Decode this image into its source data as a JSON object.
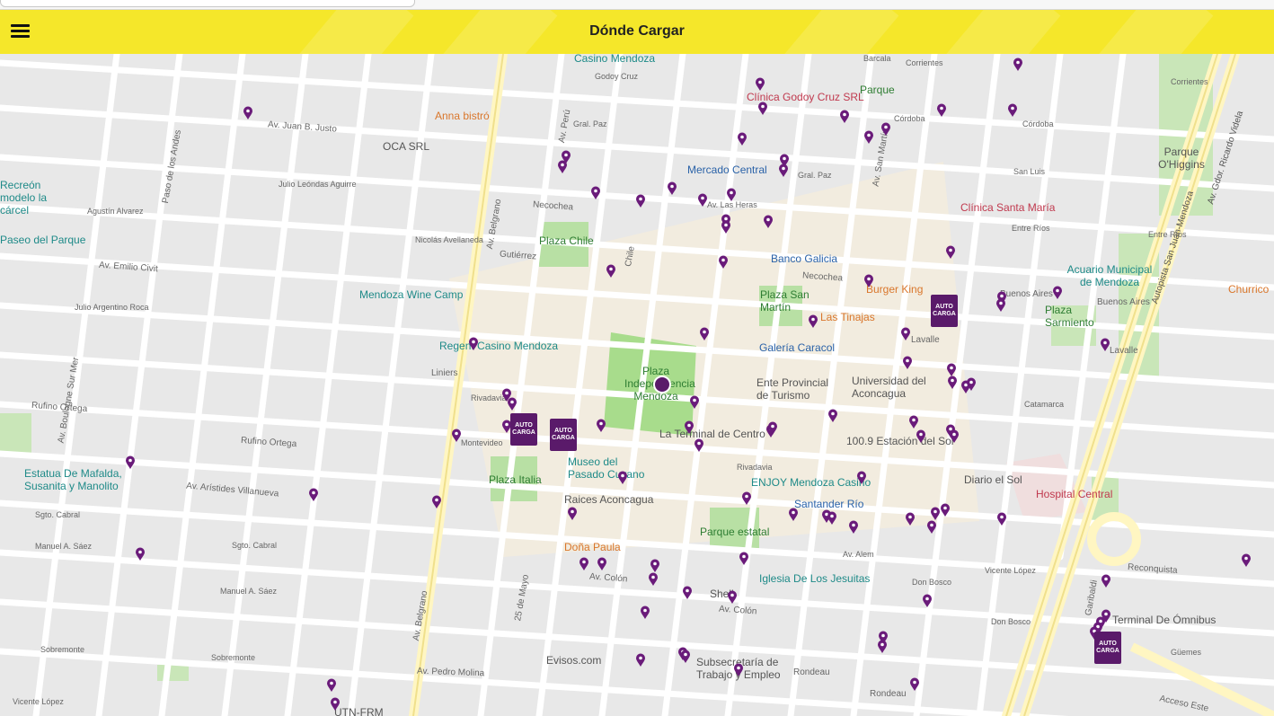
{
  "app": {
    "title": "Dónde Cargar",
    "menu_icon": "hamburger-menu-icon",
    "header_color": "#f5e72a",
    "pin_color": "#6a1b7a"
  },
  "map": {
    "streets": [
      "Av. Juan B. Justo",
      "Julio Leóndas Aguirre",
      "Agustín Alvarez",
      "Av. Emilio Civit",
      "Nicolás Avellaneda",
      "Gutiérrez",
      "Necochea",
      "Av. Boulogne Sur Mer",
      "Julio Argentino Roca",
      "Rufino Ortega",
      "Av. Arístides Villanueva",
      "Av. Belgrano",
      "Av. Colón",
      "Av. Pedro Molina",
      "Rivadavia",
      "Montevideo",
      "Godoy Cruz",
      "Av. San Martín",
      "Av. Las Heras",
      "Buenos Aires",
      "Lavalle",
      "Catamarca",
      "Garibaldi",
      "Reconquista",
      "Acceso Este",
      "Rondeau",
      "Autopista San Juan-Mendoza",
      "Av. Gdor. Ricardo Videla",
      "25 de Mayo",
      "Av. Perú",
      "Chile",
      "Corrientes",
      "Córdoba",
      "San Luis",
      "Entre Ríos",
      "Sgto. Cabral",
      "Manuel A. Sáez",
      "Sobremonte",
      "Vicente López",
      "Don Bosco",
      "Güemes",
      "Gral. Paz",
      "Av. Alem",
      "Barcala",
      "Paso de los Andes"
    ],
    "places": [
      {
        "name": "Casino Mendoza",
        "kind": "teal"
      },
      {
        "name": "Clínica Godoy Cruz SRL",
        "kind": "red"
      },
      {
        "name": "Parque",
        "kind": "green"
      },
      {
        "name": "Anna bistró",
        "kind": "orange"
      },
      {
        "name": "OCA SRL",
        "kind": "gray"
      },
      {
        "name": "Mercado Central",
        "kind": "blue"
      },
      {
        "name": "Parque O'Higgins",
        "kind": "gray"
      },
      {
        "name": "Clínica Santa María",
        "kind": "red"
      },
      {
        "name": "Plaza Chile",
        "kind": "green"
      },
      {
        "name": "Banco Galicia",
        "kind": "blue"
      },
      {
        "name": "Acuario Municipal de Mendoza",
        "kind": "teal"
      },
      {
        "name": "Churrico",
        "kind": "orange"
      },
      {
        "name": "Mendoza Wine Camp",
        "kind": "teal"
      },
      {
        "name": "Burger King",
        "kind": "orange"
      },
      {
        "name": "Plaza San Martín",
        "kind": "green"
      },
      {
        "name": "Las Tinajas",
        "kind": "orange"
      },
      {
        "name": "Plaza Sarmiento",
        "kind": "green"
      },
      {
        "name": "Regent Casino Mendoza",
        "kind": "teal"
      },
      {
        "name": "Galería Caracol",
        "kind": "blue"
      },
      {
        "name": "Plaza Independencia Mendoza",
        "kind": "green"
      },
      {
        "name": "Ente Provincial de Turismo",
        "kind": "gray"
      },
      {
        "name": "Universidad del Aconcagua",
        "kind": "gray"
      },
      {
        "name": "La Terminal de Centro",
        "kind": "gray"
      },
      {
        "name": "100.9 Estación del Sol",
        "kind": "gray"
      },
      {
        "name": "Museo del Pasado Cuyano",
        "kind": "teal"
      },
      {
        "name": "Plaza Italia",
        "kind": "green"
      },
      {
        "name": "Raices Aconcagua",
        "kind": "gray"
      },
      {
        "name": "ENJOY Mendoza Casino",
        "kind": "teal"
      },
      {
        "name": "Diario el Sol",
        "kind": "gray"
      },
      {
        "name": "Hospital Central",
        "kind": "red"
      },
      {
        "name": "Santander Río",
        "kind": "blue"
      },
      {
        "name": "Doña Paula",
        "kind": "orange"
      },
      {
        "name": "Parque estatal",
        "kind": "green"
      },
      {
        "name": "Iglesia De Los Jesuitas",
        "kind": "teal"
      },
      {
        "name": "Shell",
        "kind": "gray"
      },
      {
        "name": "Terminal De Ómnibus",
        "kind": "gray"
      },
      {
        "name": "Evisos.com",
        "kind": "gray"
      },
      {
        "name": "Subsecretaría de Trabajo y Empleo",
        "kind": "gray"
      },
      {
        "name": "UTN-FRM",
        "kind": "gray"
      },
      {
        "name": "Estatua De Mafalda, Susanita y Manolito",
        "kind": "teal"
      },
      {
        "name": "Paseo del Parque",
        "kind": "teal"
      },
      {
        "name": "Recreón modelo la cárcel",
        "kind": "teal"
      },
      {
        "name": "Liniers",
        "kind": "gray"
      }
    ],
    "autocarga_label": "AUTO CARGA"
  }
}
